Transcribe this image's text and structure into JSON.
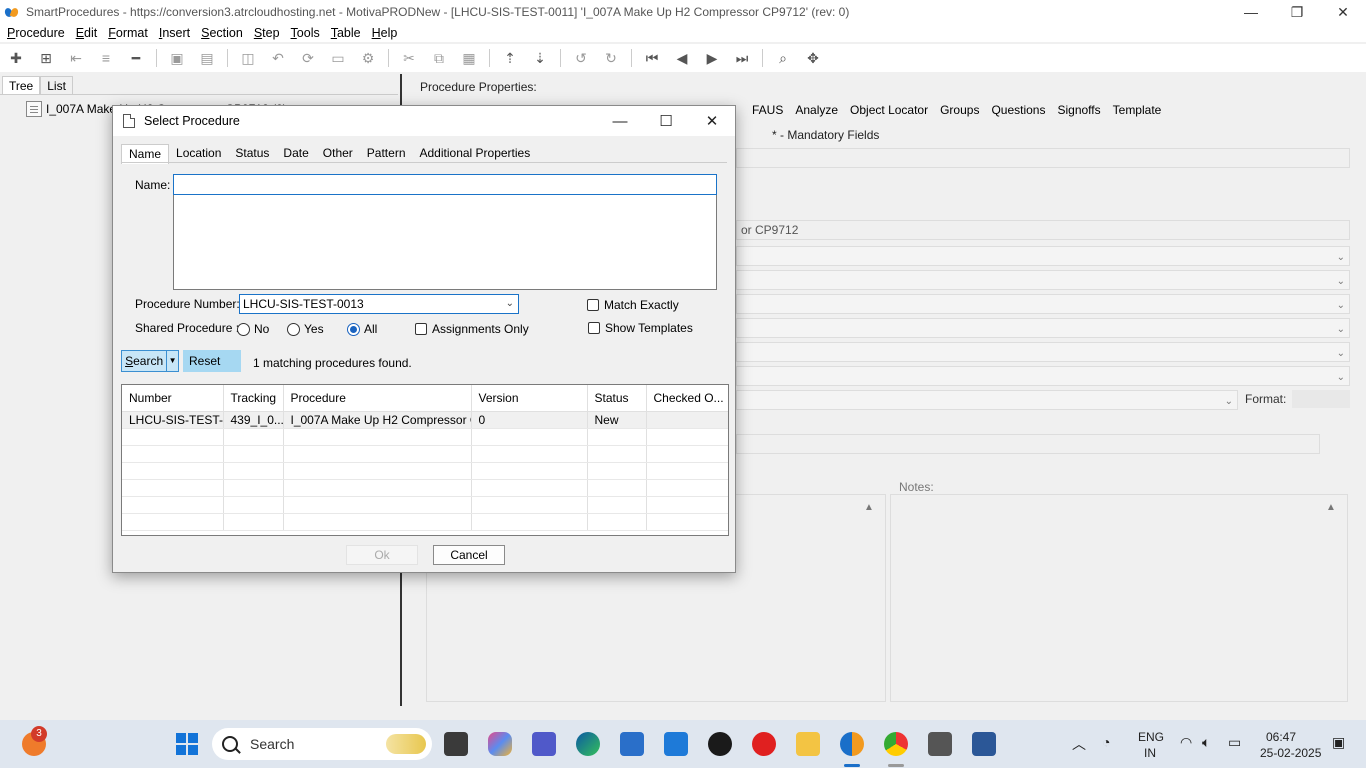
{
  "window": {
    "title": "SmartProcedures - https://conversion3.atrcloudhosting.net - MotivaPRODNew - [LHCU-SIS-TEST-0011] 'I_007A Make Up H2 Compressor CP9712' (rev: 0)",
    "minimize": "—",
    "maximize": "❐",
    "close": "✕"
  },
  "menu": [
    "Procedure",
    "Edit",
    "Format",
    "Insert",
    "Section",
    "Step",
    "Tools",
    "Table",
    "Help"
  ],
  "left_panel": {
    "tabs": [
      "Tree",
      "List"
    ],
    "tree_node": "I_007A Make Up H2 Compressor CP9712 (0)"
  },
  "right_panel": {
    "title": "Procedure Properties:",
    "tabs": [
      "FAUS",
      "Analyze",
      "Object Locator",
      "Groups",
      "Questions",
      "Signoffs",
      "Template"
    ],
    "mandatory": "* - Mandatory Fields",
    "name_fragment": "or CP9712",
    "format_label": "Format:",
    "notes_label": "Notes:"
  },
  "dialog": {
    "title": "Select Procedure",
    "tabs": [
      "Name",
      "Location",
      "Status",
      "Date",
      "Other",
      "Pattern",
      "Additional Properties"
    ],
    "name_label": "Name:",
    "name_value": "",
    "procedure_number_label": "Procedure Number:",
    "procedure_number_value": "LHCU-SIS-TEST-0013",
    "shared_label": "Shared Procedure :",
    "shared_options": [
      "No",
      "Yes",
      "All"
    ],
    "shared_selected": "All",
    "assignments_only": "Assignments Only",
    "match_exactly": "Match Exactly",
    "show_templates": "Show Templates",
    "search_btn": "Search",
    "reset_btn": "Reset",
    "match_count": "1 matching procedures found.",
    "grid": {
      "columns": [
        "Number",
        "Tracking",
        "Procedure",
        "Version",
        "Status",
        "Checked O..."
      ],
      "rows": [
        [
          "LHCU-SIS-TEST-...",
          "439_I_0...",
          "I_007A Make Up H2 Compressor C...",
          "0",
          "New",
          ""
        ]
      ]
    },
    "ok_btn": "Ok",
    "cancel_btn": "Cancel"
  },
  "taskbar": {
    "weather_badge": "3",
    "search_text": "Search",
    "lang_top": "ENG",
    "lang_bottom": "IN",
    "time": "06:47",
    "date": "25-02-2025"
  }
}
